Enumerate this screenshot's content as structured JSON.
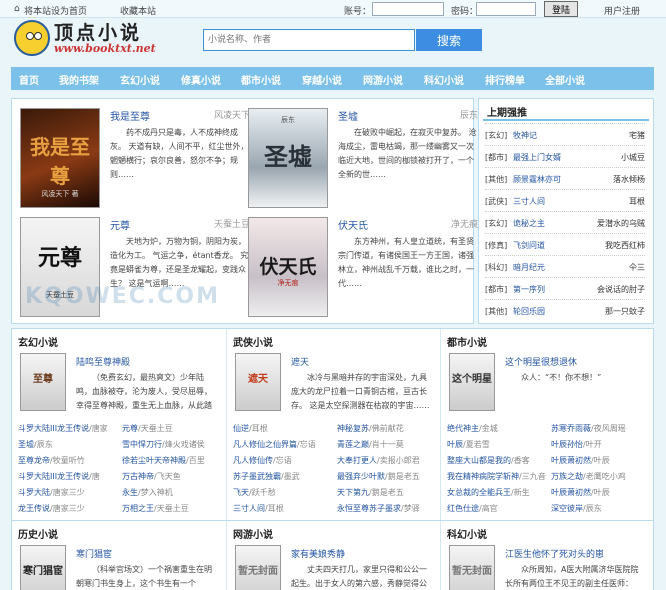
{
  "topbar": {
    "set_home": "将本站设为首页",
    "bookmark": "收藏本站",
    "account_label": "账号：",
    "password_label": "密码：",
    "login_label": "登陆",
    "register": "用户注册"
  },
  "logo": {
    "title": "顶点小说",
    "url": "www.booktxt.net"
  },
  "search": {
    "placeholder": "小说名称、作者",
    "button": "搜索"
  },
  "nav": [
    "首页",
    "我的书架",
    "玄幻小说",
    "修真小说",
    "都市小说",
    "穿越小说",
    "网游小说",
    "科幻小说",
    "排行榜单",
    "全部小说"
  ],
  "featured": [
    {
      "title": "我是至尊",
      "author": "风凌天下",
      "desc": "药不成丹只是毒，人不成神终成灰。 天道有缺，人间不平，红尘世外，魍魉横行；哀尔良善，怒尔不争；规则……",
      "cover_text": "我是至尊",
      "cover_sub": "风凌天下 著",
      "color": "#8a3a14"
    },
    {
      "title": "圣墟",
      "author": "辰东",
      "desc": "在破败中崛起，在寂灭中复苏。 沧海成尘，雷电枯竭，那一缕幽雾又一次临近大地，世间的枷锁被打开了，一个全新的世……",
      "cover_text": "圣墟",
      "cover_sub": "辰东",
      "color": "#5a6470"
    },
    {
      "title": "元尊",
      "author": "天蚕土豆",
      "desc": "天地为炉，万物为铜，阴阳为炭，造化为工。 气运之争，étant香龙。 究竟是蟒雀为尊，还是圣龙耀起，变践众生？ 这是气运啊……",
      "cover_text": "元尊",
      "cover_sub": "天蚕土豆",
      "color": "#2a2a2a"
    },
    {
      "title": "伏天氏",
      "author": "净无痕",
      "desc": "东方神州，有人皇立道统，有圣贤宗门传道，有诸侯国王一方王国，诸强林立，神州战乱千万载，谁比之时，一代……",
      "cover_text": "伏天氏",
      "cover_sub": "净无痕",
      "color": "#b0201a"
    }
  ],
  "rank": {
    "title": "上期强推",
    "items": [
      {
        "cat": "[玄幻]",
        "name": "牧神记",
        "author": "宅猪"
      },
      {
        "cat": "[都市]",
        "name": "最强上门女婿",
        "author": "小城豆"
      },
      {
        "cat": "[其他]",
        "name": "顾景霆林亦可",
        "author": "落水倾杨"
      },
      {
        "cat": "[武侠]",
        "name": "三寸人间",
        "author": "耳根"
      },
      {
        "cat": "[玄幻]",
        "name": "诡秘之主",
        "author": "爱潜水的乌贼"
      },
      {
        "cat": "[修真]",
        "name": "飞剑问道",
        "author": "我吃西红柿"
      },
      {
        "cat": "[科幻]",
        "name": "暗月纪元",
        "author": "仐三"
      },
      {
        "cat": "[都市]",
        "name": "第一序列",
        "author": "会说话的肘子"
      },
      {
        "cat": "[其他]",
        "name": "轮回乐园",
        "author": "那一只蚊子"
      }
    ]
  },
  "watermark": "KQOWEC.COM",
  "sections": [
    {
      "title": "玄幻小说",
      "feature": {
        "title": "陆鸣至尊神殿",
        "desc": "（免费玄幻，最热爽文）少年陆鸣，血脉被夺，沦为废人，受尽屈辱，幸得至尊神殿，重生无上血脉，从此踏破天才，一……",
        "cover": "至尊",
        "color": "#6a3a1a"
      },
      "list": [
        [
          "斗罗大陆III龙王传说",
          "/唐家"
        ],
        [
          "元尊",
          "/天蚕土豆"
        ],
        [
          "圣墟",
          "/辰东"
        ],
        [
          "雪中悍刀行",
          "/烽火戏诸侯"
        ],
        [
          "至尊龙帝",
          "/牧童听竹"
        ],
        [
          "徐若尘叶天帝神殿",
          "/百里"
        ],
        [
          "斗罗大陆III龙王传说",
          "/唐"
        ],
        [
          "万古神帝",
          "/飞天鱼"
        ],
        [
          "斗罗大陆",
          "/唐家三少"
        ],
        [
          "永生",
          "/梦入神机"
        ],
        [
          "龙王传说",
          "/唐家三少"
        ],
        [
          "万相之王",
          "/天蚕土豆"
        ]
      ]
    },
    {
      "title": "武侠小说",
      "feature": {
        "title": "遮天",
        "desc": "冰冷与黑暗并存的宇宙深处，九具庞大的龙尸拉着一口青铜古棺，亘古长存。 这是太空探测器在枯寂的宇宙……",
        "cover": "遮天",
        "color": "#c23a1a"
      },
      "list": [
        [
          "仙逆",
          "/耳根"
        ],
        [
          "神秘复苏",
          "/佛前献花"
        ],
        [
          "凡人修仙之仙界篇",
          "/忘语"
        ],
        [
          "青莲之巅",
          "/肖十一莫"
        ],
        [
          "凡人修仙传",
          "/忘语"
        ],
        [
          "大奉打更人",
          "/卖报小郎君"
        ],
        [
          "苏子墨武独霸",
          "/墨武"
        ],
        [
          "最强弃少叶默",
          "/鹅是老五"
        ],
        [
          "飞天",
          "/跃千愁"
        ],
        [
          "天下第九",
          "/鹅是老五"
        ],
        [
          "三寸人间",
          "/耳根"
        ],
        [
          "永恒至尊苏子墨求",
          "/梦驿"
        ]
      ]
    },
    {
      "title": "都市小说",
      "feature": {
        "title": "这个明星很想退休",
        "desc": "众人：“不！你不想！”",
        "cover": "这个明星",
        "color": "#333"
      },
      "list": [
        [
          "绝代神主",
          "/金城"
        ],
        [
          "苏寒乔雨薇",
          "/夜风周瑶"
        ],
        [
          "叶辰",
          "/夏若雪"
        ],
        [
          "叶辰孙怡",
          "/叶开"
        ],
        [
          "整座大山都是我的",
          "/香客"
        ],
        [
          "叶辰萧初然",
          "/叶辰"
        ],
        [
          "我在精神病院学斩神",
          "/三九音"
        ],
        [
          "万族之劫",
          "/老鹰吃小鸡"
        ],
        [
          "女总裁的全能兵王",
          "/新生"
        ],
        [
          "叶辰萧初然",
          "/叶辰"
        ],
        [
          "红色仕途",
          "/高官"
        ],
        [
          "深空彼岸",
          "/辰东"
        ]
      ]
    },
    {
      "title": "历史小说",
      "feature": {
        "title": "寒门猖宦",
        "desc": "（科举官场文）一个祸害重生在明朝寒门书生身上，这个书生有一个强……",
        "cover": "寒门猖宦",
        "color": "#222"
      },
      "list": []
    },
    {
      "title": "网游小说",
      "feature": {
        "title": "家有美娘秀静",
        "desc": "丈夫四天打几，家里只得和公公一起生。出于女人的第六感，秀静觉得公公看……",
        "cover": "暂无封面",
        "color": "#777"
      },
      "list": []
    },
    {
      "title": "科幻小说",
      "feature": {
        "title": "江医生他怀了死对头的崽",
        "desc": "众所周知，A医大附属济华医院院长所有两位王不见王的副主任医师：江……",
        "cover": "暂无封面",
        "color": "#777"
      },
      "list": []
    }
  ]
}
